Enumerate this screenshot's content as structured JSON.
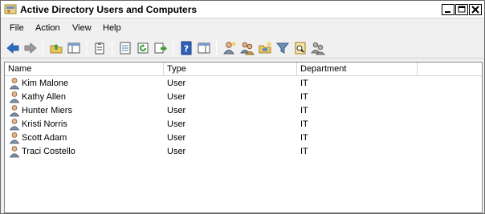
{
  "window": {
    "title": "Active Directory Users and Computers",
    "icon": "ad-console-icon"
  },
  "menu": [
    "File",
    "Action",
    "View",
    "Help"
  ],
  "toolbar": {
    "buttons": [
      {
        "icon": "back-arrow-icon",
        "label": "Back"
      },
      {
        "icon": "forward-arrow-icon",
        "label": "Forward"
      },
      {
        "icon": "up-folder-icon",
        "label": "Up one level"
      },
      {
        "icon": "console-tree-icon",
        "label": "Show/Hide console tree"
      },
      {
        "icon": "clipboard-icon",
        "label": "Paste"
      },
      {
        "icon": "properties-icon",
        "label": "Properties"
      },
      {
        "icon": "refresh-icon",
        "label": "Refresh"
      },
      {
        "icon": "export-list-icon",
        "label": "Export list"
      },
      {
        "icon": "help-icon",
        "label": "Help"
      },
      {
        "icon": "show-action-pane-icon",
        "label": "Show/Hide action pane"
      },
      {
        "icon": "new-user-icon",
        "label": "Create a new user"
      },
      {
        "icon": "new-group-icon",
        "label": "Create a new group"
      },
      {
        "icon": "new-ou-icon",
        "label": "Create a new organizational unit"
      },
      {
        "icon": "filter-icon",
        "label": "Filter"
      },
      {
        "icon": "find-icon",
        "label": "Find"
      },
      {
        "icon": "add-to-group-icon",
        "label": "Add to group"
      }
    ]
  },
  "list": {
    "columns": [
      "Name",
      "Type",
      "Department",
      ""
    ],
    "rows": [
      {
        "name": "Kim Malone",
        "type": "User",
        "department": "IT"
      },
      {
        "name": "Kathy Allen",
        "type": "User",
        "department": "IT"
      },
      {
        "name": "Hunter Miers",
        "type": "User",
        "department": "IT"
      },
      {
        "name": "Kristi Norris",
        "type": "User",
        "department": "IT"
      },
      {
        "name": "Scott Adam",
        "type": "User",
        "department": "IT"
      },
      {
        "name": "Traci Costello",
        "type": "User",
        "department": "IT"
      }
    ]
  },
  "colors": {
    "background": "#f0f0f0",
    "list_background": "#ffffff",
    "header_border": "#d5d5d5",
    "back_arrow": "#2a6cc4",
    "help_blue": "#2f5fb8"
  }
}
